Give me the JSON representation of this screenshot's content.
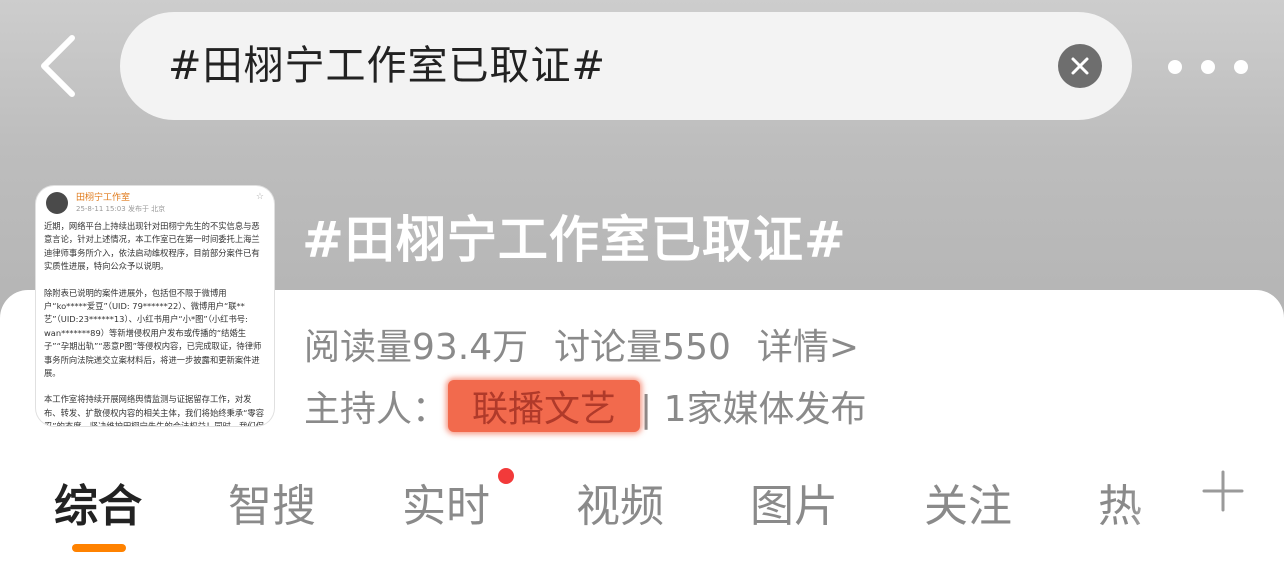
{
  "search": {
    "query": "#田栩宁工作室已取证#"
  },
  "topic": {
    "title": "#田栩宁工作室已取证#",
    "reads": "阅读量93.4万",
    "discussions": "讨论量550",
    "details_link": "详情>",
    "host_label": "主持人：",
    "host_name": "联播文艺",
    "media_count": "| 1家媒体发布"
  },
  "thumbnail": {
    "account_name": "田栩宁工作室",
    "meta": "25-8-11 15:03 发布于 北京",
    "paragraphs": [
      "近期，网络平台上持续出现针对田栩宁先生的不实信息与恶意言论，针对上述情况，本工作室已在第一时间委托上海兰迪律师事务所介入，依法启动维权程序，目前部分案件已有实质性进展，特向公众予以说明。",
      "除附表已说明的案件进展外，包括但不限于微博用户“ko*****爱豆”（UID: 79******22）、微博用户“联**艺”（UID:23******13）、小红书用户“小*图”（小红书号: wan*******89）等新增侵权用户发布或传播的“结婚生子”“孕期出轨”“恶意P图”等侵权内容，已完成取证，待律师事务所向法院递交立案材料后，将进一步披露和更新案件进展。",
      "本工作室将持续开展网络舆情监测与证据留存工作，对发布、转发、扩散侵权内容的相关主体，我们将始终秉承“零容忍”的态度，坚决维护田栩宁先生的合法权益！同时，我们保留后续并将制定处理的权利，严重侵权者一律追究到底。"
    ]
  },
  "tabs": [
    {
      "label": "综合",
      "active": true
    },
    {
      "label": "智搜",
      "active": false
    },
    {
      "label": "实时",
      "active": false,
      "dot": true
    },
    {
      "label": "视频",
      "active": false
    },
    {
      "label": "图片",
      "active": false
    },
    {
      "label": "关注",
      "active": false
    },
    {
      "label": "热",
      "active": false
    }
  ],
  "colors": {
    "accent": "#ff8200",
    "notification_dot": "#f23a3a",
    "host_highlight": "#f26a4d"
  },
  "icons": {
    "back": "chevron-left-icon",
    "clear": "close-icon",
    "more": "more-dots-icon",
    "add_tab": "plus-icon"
  }
}
